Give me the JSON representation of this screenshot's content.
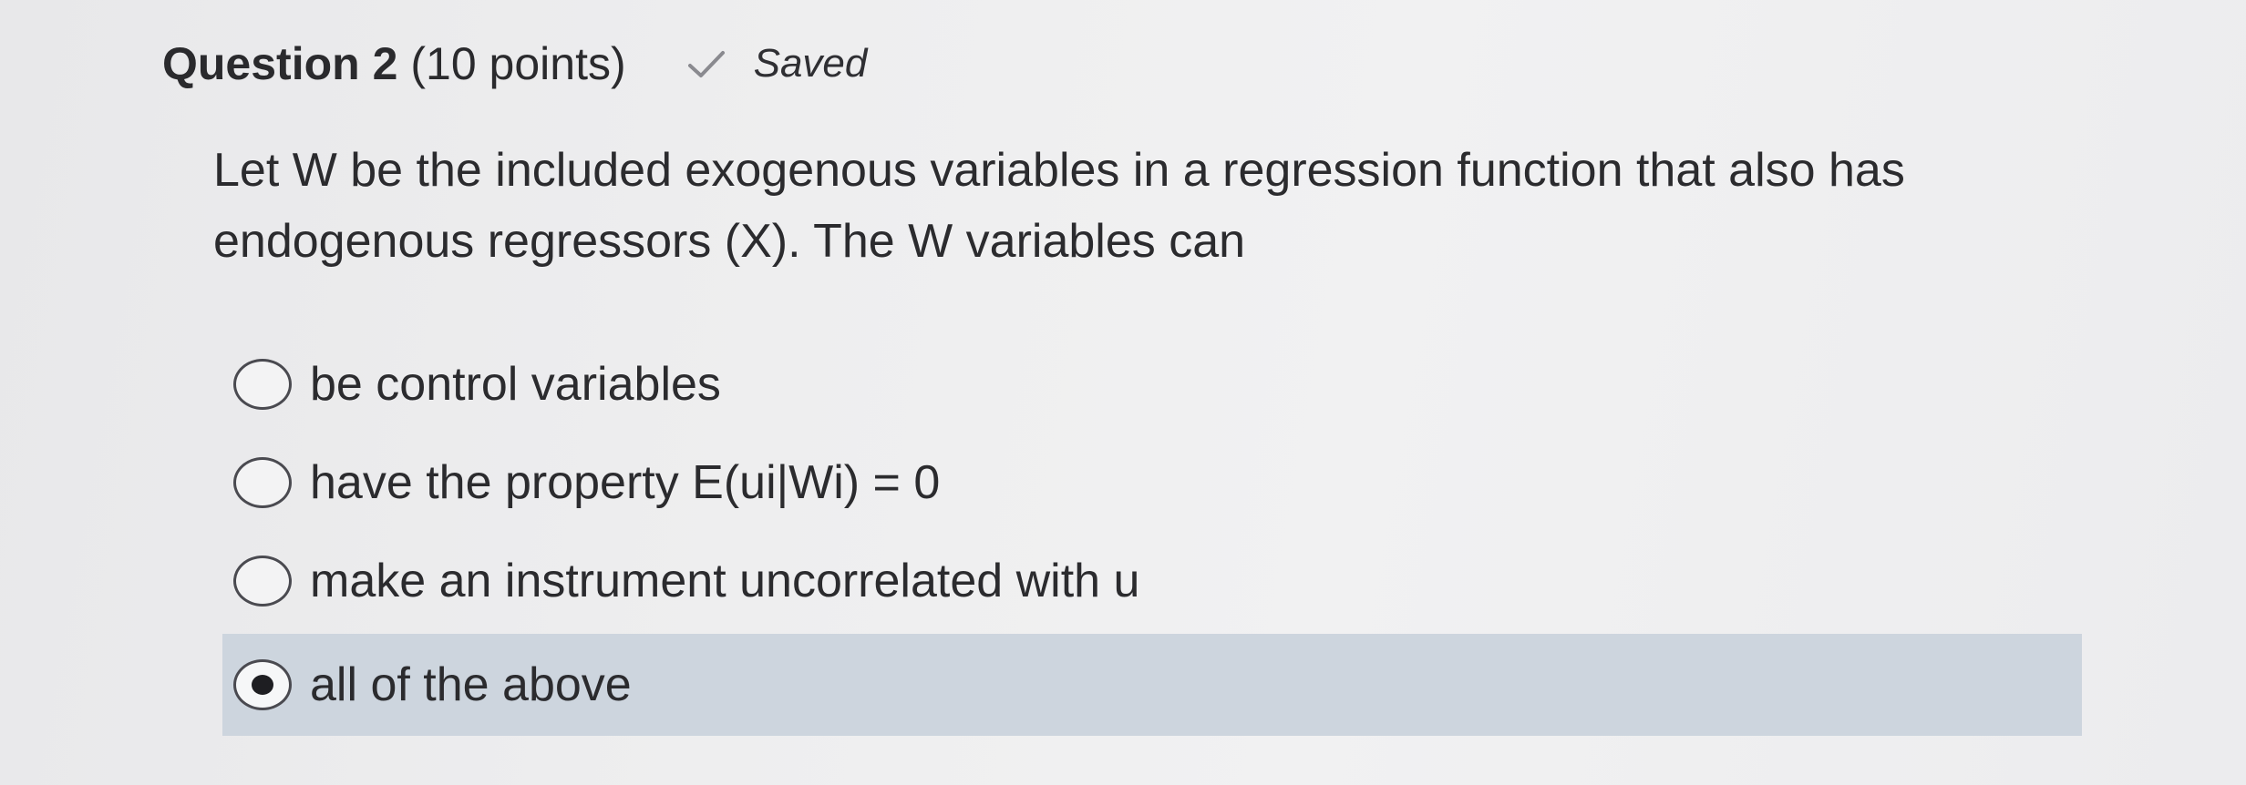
{
  "question": {
    "title": "Question 2",
    "points": "(10 points)",
    "status_icon": "checkmark-icon",
    "status": "Saved"
  },
  "prompt": {
    "line1": "Let W be the included exogenous variables in a regression function that also has",
    "line2": "endogenous regressors (X). The W variables can"
  },
  "options": [
    {
      "label": "be control variables",
      "selected": false
    },
    {
      "label": "have the property E(ui|Wi) = 0",
      "selected": false
    },
    {
      "label": "make an instrument uncorrelated with u",
      "selected": false
    },
    {
      "label": "all of the above",
      "selected": true
    }
  ],
  "colors": {
    "selected_row": "#cdd5de",
    "text": "#2b2b2e"
  }
}
